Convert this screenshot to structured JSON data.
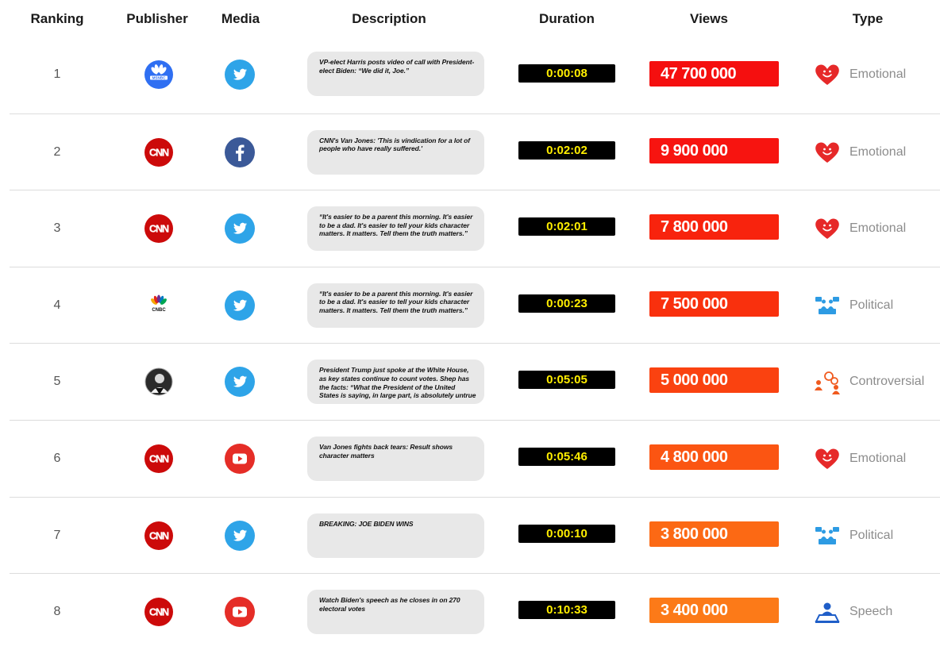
{
  "headers": {
    "ranking": "Ranking",
    "publisher": "Publisher",
    "media": "Media",
    "description": "Description",
    "duration": "Duration",
    "views": "Views",
    "type": "Type"
  },
  "rows": [
    {
      "rank": "1",
      "publisher": "msnbc-logo",
      "media": "twitter-icon",
      "description": "VP-elect Harris posts video of call with President-elect Biden: “We did it, Joe.”",
      "duration": "0:00:08",
      "views": "47 700 000",
      "views_color": "#f50f0f",
      "type": "Emotional",
      "type_icon": "heart-smile-icon"
    },
    {
      "rank": "2",
      "publisher": "cnn-logo",
      "media": "facebook-icon",
      "description": "CNN's Van Jones: 'This is vindication for a lot of people who have really suffered.'",
      "duration": "0:02:02",
      "views": "9 900 000",
      "views_color": "#f71410",
      "type": "Emotional",
      "type_icon": "heart-smile-icon"
    },
    {
      "rank": "3",
      "publisher": "cnn-logo",
      "media": "twitter-icon",
      "description": "“It's easier to be a parent this morning. It's easier to be a dad. It's easier to tell your kids character matters. It matters. Tell them the truth matters.”",
      "duration": "0:02:01",
      "views": "7 800 000",
      "views_color": "#f8230d",
      "type": "Emotional",
      "type_icon": "heart-smile-icon"
    },
    {
      "rank": "4",
      "publisher": "cnbc-logo",
      "media": "twitter-icon",
      "description": "“It's easier to be a parent this morning. It's easier to be a dad. It's easier to tell your kids character matters. It matters. Tell them the truth matters.”",
      "duration": "0:00:23",
      "views": "7 500 000",
      "views_color": "#f9300d",
      "type": "Political",
      "type_icon": "political-icon"
    },
    {
      "rank": "5",
      "publisher": "person-avatar",
      "media": "twitter-icon",
      "description": "President Trump just spoke at the White House, as key states continue to count votes. Shep has the facts: “What the President of the United States is saying, in large part, is absolutely untrue",
      "duration": "0:05:05",
      "views": "5 000 000",
      "views_color": "#fa4210",
      "type": "Controversial",
      "type_icon": "controversial-icon"
    },
    {
      "rank": "6",
      "publisher": "cnn-logo",
      "media": "youtube-icon",
      "description": "Van Jones fights back tears: Result shows character matters",
      "duration": "0:05:46",
      "views": "4 800 000",
      "views_color": "#fb5512",
      "type": "Emotional",
      "type_icon": "heart-smile-icon"
    },
    {
      "rank": "7",
      "publisher": "cnn-logo",
      "media": "twitter-icon",
      "description": "BREAKING: JOE BIDEN WINS",
      "duration": "0:00:10",
      "views": "3 800 000",
      "views_color": "#fc6914",
      "type": "Political",
      "type_icon": "political-icon"
    },
    {
      "rank": "8",
      "publisher": "cnn-logo",
      "media": "youtube-icon",
      "description": "Watch Biden's speech as he closes in on 270 electoral votes",
      "duration": "0:10:33",
      "views": "3 400 000",
      "views_color": "#fc7a18",
      "type": "Speech",
      "type_icon": "speech-icon"
    }
  ]
}
